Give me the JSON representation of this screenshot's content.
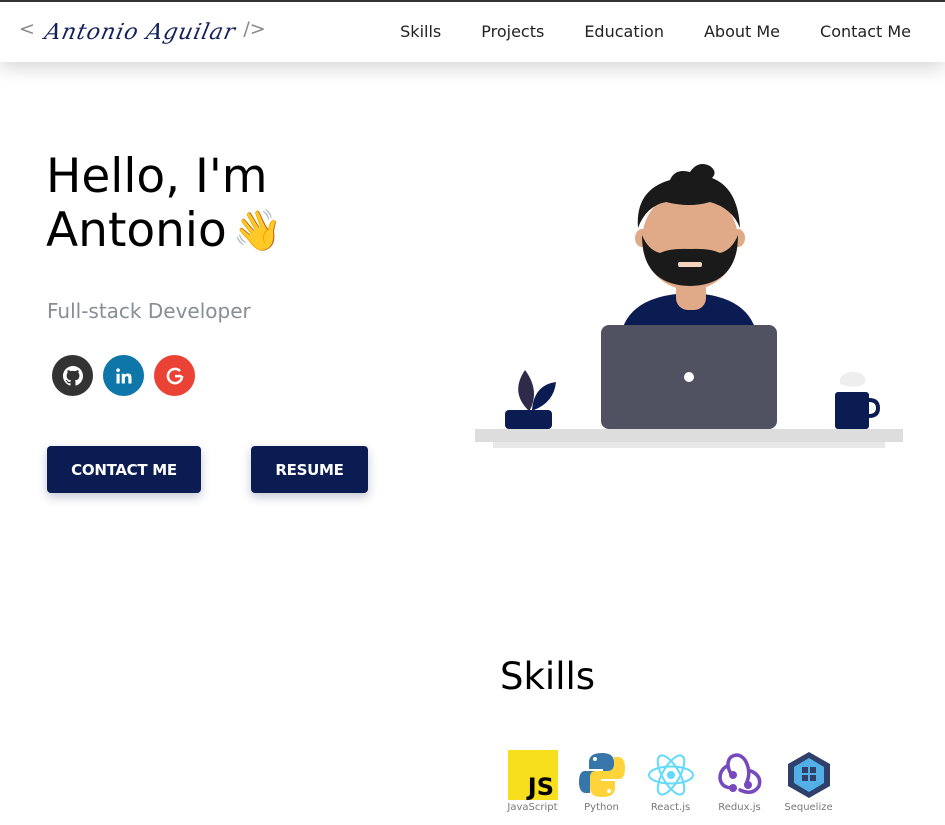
{
  "header": {
    "logo": {
      "open": "<",
      "name": "Antonio Aguilar",
      "close": "/>"
    },
    "nav": [
      "Skills",
      "Projects",
      "Education",
      "About Me",
      "Contact Me"
    ]
  },
  "hero": {
    "greeting_line1": "Hello, I'm",
    "greeting_line2": "Antonio",
    "wave": "👋",
    "subtitle": "Full-stack Developer",
    "socials": [
      {
        "name": "github-icon",
        "color": "#333333"
      },
      {
        "name": "linkedin-icon",
        "color": "#0e76a8"
      },
      {
        "name": "google-icon",
        "color": "#ea4335"
      }
    ],
    "buttons": {
      "contact": "CONTACT ME",
      "resume": "RESUME"
    }
  },
  "skills": {
    "title": "Skills",
    "items": [
      {
        "label": "JavaScript",
        "icon": "javascript-icon"
      },
      {
        "label": "Python",
        "icon": "python-icon"
      },
      {
        "label": "React.js",
        "icon": "react-icon"
      },
      {
        "label": "Redux.js",
        "icon": "redux-icon"
      },
      {
        "label": "Sequelize",
        "icon": "sequelize-icon"
      }
    ]
  },
  "colors": {
    "accent": "#0b1c52",
    "subtitle": "#868e96"
  }
}
